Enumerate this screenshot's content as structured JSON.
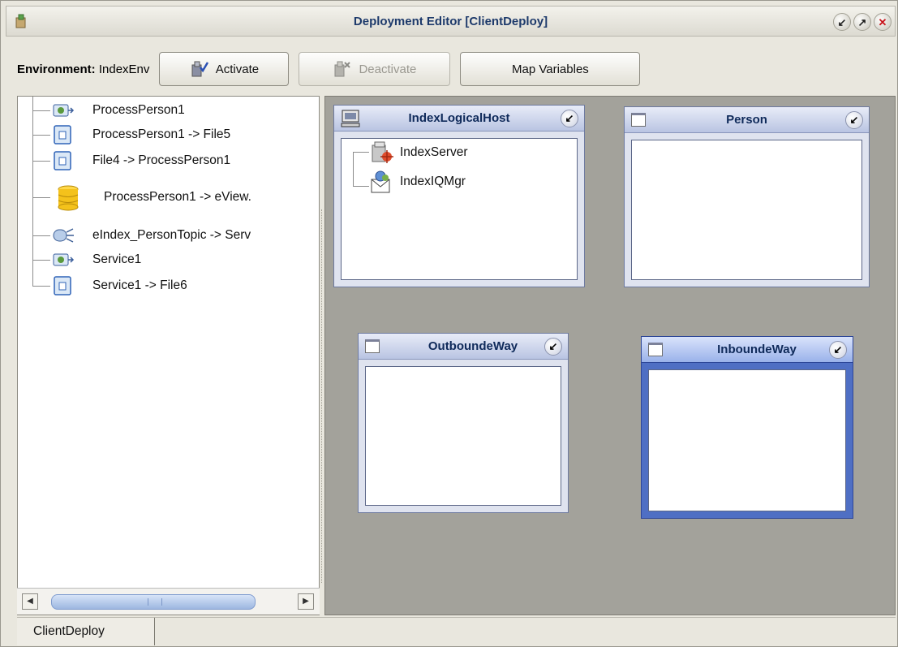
{
  "window": {
    "title": "Deployment Editor [ClientDeploy]",
    "buttons": [
      "restore",
      "maximize",
      "close"
    ]
  },
  "toolbar": {
    "env_label": "Environment:",
    "env_value": "IndexEnv",
    "activate_label": "Activate",
    "deactivate_label": "Deactivate",
    "map_variables_label": "Map Variables"
  },
  "tree": {
    "items": [
      {
        "label": "ProcessPerson1",
        "icon": "service-icon"
      },
      {
        "label": "ProcessPerson1 -> File5",
        "icon": "connection-icon"
      },
      {
        "label": "File4 -> ProcessPerson1",
        "icon": "connection-icon"
      },
      {
        "label": "ProcessPerson1 -> eView.",
        "icon": "database-icon"
      },
      {
        "label": "eIndex_PersonTopic -> Serv",
        "icon": "topic-icon"
      },
      {
        "label": "Service1",
        "icon": "service-icon"
      },
      {
        "label": "Service1 -> File6",
        "icon": "connection-icon"
      }
    ]
  },
  "canvas": {
    "boxes": [
      {
        "title": "IndexLogicalHost",
        "items": [
          {
            "label": "IndexServer"
          },
          {
            "label": "IndexIQMgr"
          }
        ]
      },
      {
        "title": "Person"
      },
      {
        "title": "OutboundeWay"
      },
      {
        "title": "InboundeWay",
        "selected": true
      }
    ]
  },
  "tabs": {
    "active": "ClientDeploy"
  },
  "colors": {
    "canvas": "#a3a29b",
    "title": "#1d3a6b",
    "selected_box": "#4f6fc4"
  }
}
